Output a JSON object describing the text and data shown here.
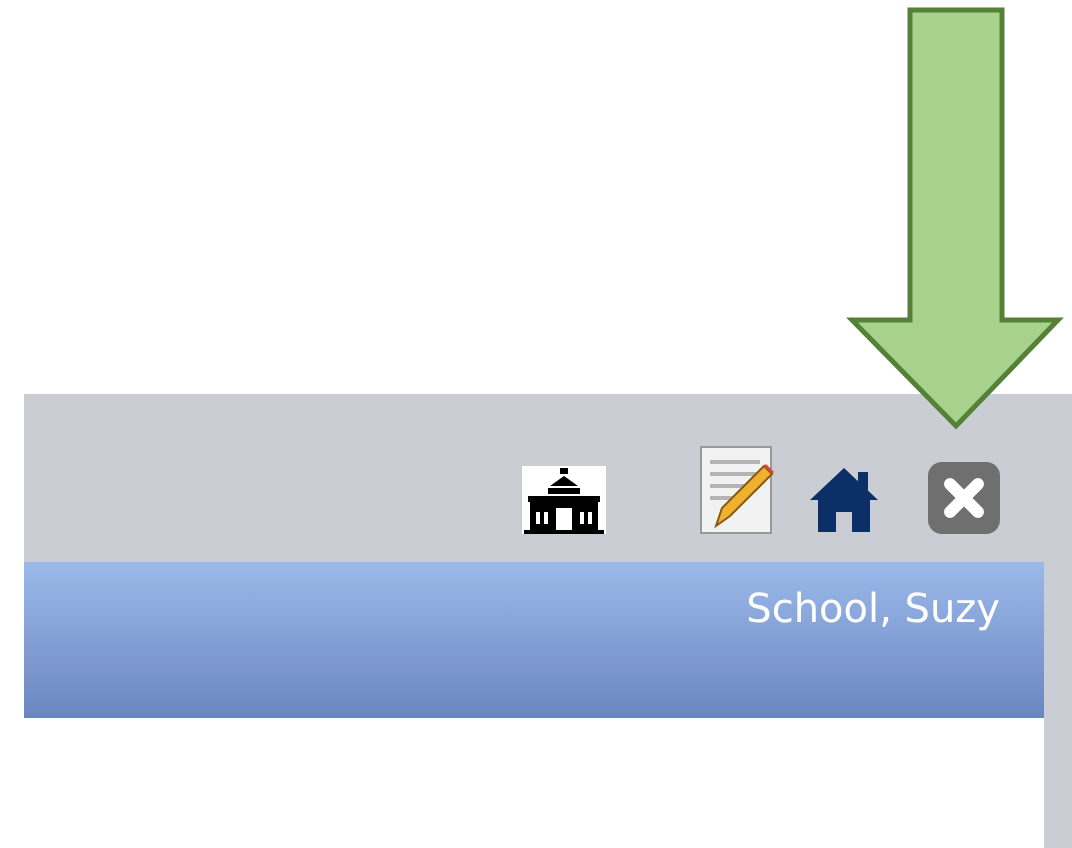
{
  "header": {
    "user_name": "School, Suzy"
  }
}
